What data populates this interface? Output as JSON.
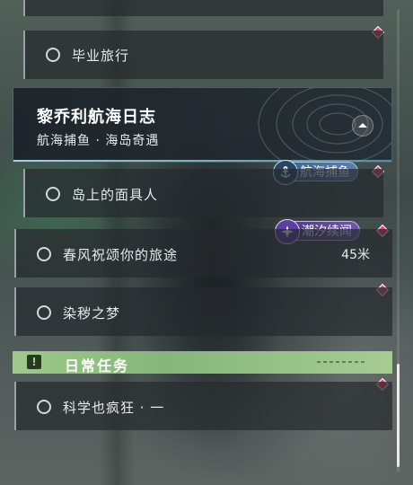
{
  "quests": {
    "graduation_trip": "毕业旅行",
    "featured": {
      "title": "黎乔利航海日志",
      "subtitle": "航海捕鱼 · 海岛奇遇"
    },
    "tag_fishing": "航海捕鱼",
    "island_mask": "岛上的面具人",
    "tag_tide": "潮汐续闻",
    "spring_wind": "春风祝颂你的旅途",
    "spring_wind_distance": "45米",
    "dyed_dream": "染秽之梦"
  },
  "daily": {
    "header": "日常任务",
    "science_madness": "科学也疯狂 · 一"
  },
  "colors": {
    "marker": "#e8456a",
    "daily_header": "#9ec98a",
    "fishing_tag": "#4a6a9a",
    "tide_tag": "#5e4a96"
  }
}
